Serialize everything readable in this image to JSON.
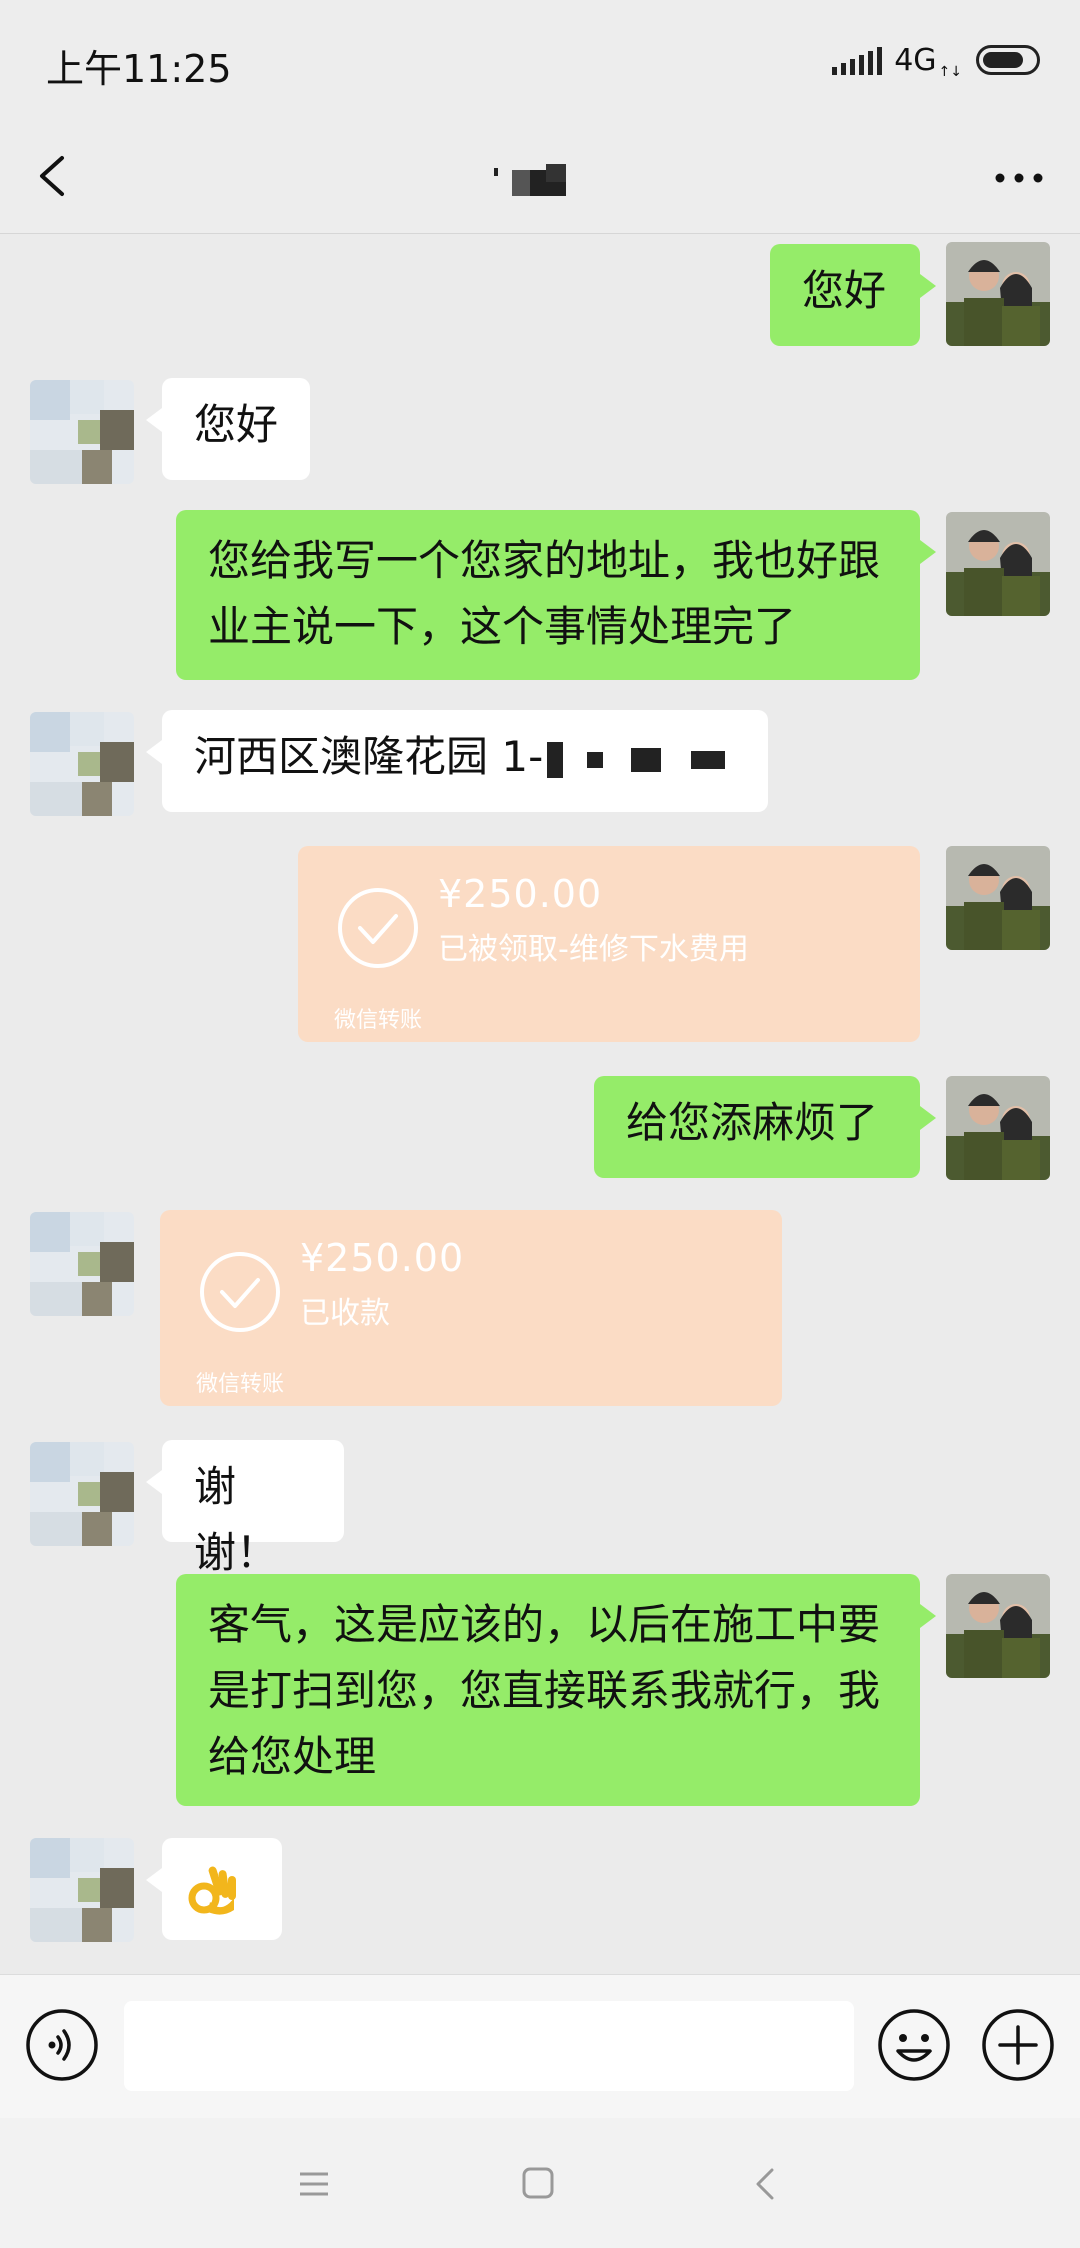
{
  "status_bar": {
    "time": "上午11:25",
    "network": "4G",
    "network_arrows": "↑↓",
    "battery_level": 0.8
  },
  "nav": {
    "back_icon": "chevron-left-icon",
    "title": "",
    "more_icon": "ellipsis-icon"
  },
  "messages": [
    {
      "side": "me",
      "type": "text",
      "text": "您好"
    },
    {
      "side": "other",
      "type": "text",
      "text": "您好"
    },
    {
      "side": "me",
      "type": "text",
      "lines": [
        "您给我写一个您家的地址，我也好跟",
        "业主说一下，这个事情处理完了"
      ]
    },
    {
      "side": "other",
      "type": "text",
      "text": "河西区澳隆花园 1-"
    },
    {
      "side": "me",
      "type": "transfer",
      "amount": "¥250.00",
      "status": "已被领取-维修下水费用",
      "footer": "微信转账"
    },
    {
      "side": "me",
      "type": "text",
      "text": "给您添麻烦了"
    },
    {
      "side": "other",
      "type": "transfer",
      "amount": "¥250.00",
      "status": "已收款",
      "footer": "微信转账"
    },
    {
      "side": "other",
      "type": "text",
      "text": "谢谢！"
    },
    {
      "side": "me",
      "type": "text",
      "lines": [
        "客气，这是应该的，以后在施工中要",
        "是打扫到您，您直接联系我就行，我",
        "给您处理"
      ]
    },
    {
      "side": "other",
      "type": "emoji",
      "text": "👌"
    }
  ],
  "input_bar": {
    "voice_icon": "voice-icon",
    "placeholder": "",
    "emoji_icon": "emoji-smile-icon",
    "plus_icon": "plus-icon"
  },
  "system_nav": {
    "menu_icon": "menu-icon",
    "home_icon": "home-square-icon",
    "back_icon": "back-triangle-icon"
  },
  "colors": {
    "my_bubble": "#95ec69",
    "other_bubble": "#ffffff",
    "transfer_bg": "#fbdcc5",
    "chat_bg": "#ebebeb"
  }
}
